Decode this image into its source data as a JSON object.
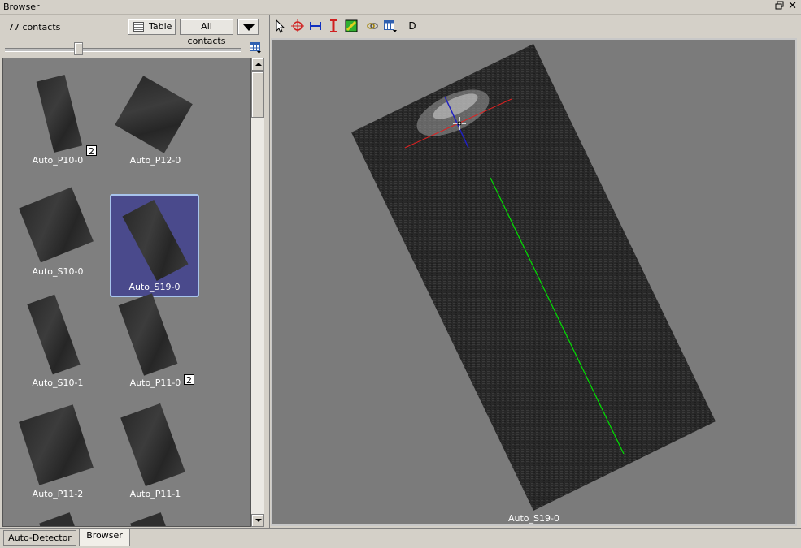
{
  "window": {
    "title": "Browser"
  },
  "browser": {
    "count_label": "77 contacts",
    "table_button": "Table",
    "filter_button": "All contacts"
  },
  "thumbnails": [
    {
      "label": "Auto_P10-0",
      "badge": "2",
      "selected": false
    },
    {
      "label": "Auto_P12-0",
      "badge": "",
      "selected": false
    },
    {
      "label": "Auto_S10-0",
      "badge": "",
      "selected": false
    },
    {
      "label": "Auto_S19-0",
      "badge": "",
      "selected": true
    },
    {
      "label": "Auto_S10-1",
      "badge": "",
      "selected": false
    },
    {
      "label": "Auto_P11-0",
      "badge": "2",
      "selected": false
    },
    {
      "label": "Auto_P11-2",
      "badge": "",
      "selected": false
    },
    {
      "label": "Auto_P11-1",
      "badge": "",
      "selected": false
    }
  ],
  "toolbar": {
    "d_label": "D"
  },
  "viewer": {
    "caption": "Auto_S19-0"
  },
  "tabs": [
    {
      "label": "Auto-Detector"
    },
    {
      "label": "Browser"
    }
  ],
  "colors": {
    "selection": "#4a4a8c",
    "measure_green": "#00e000",
    "crosshair_red": "#e02020",
    "crosshair_blue": "#2020c0"
  }
}
